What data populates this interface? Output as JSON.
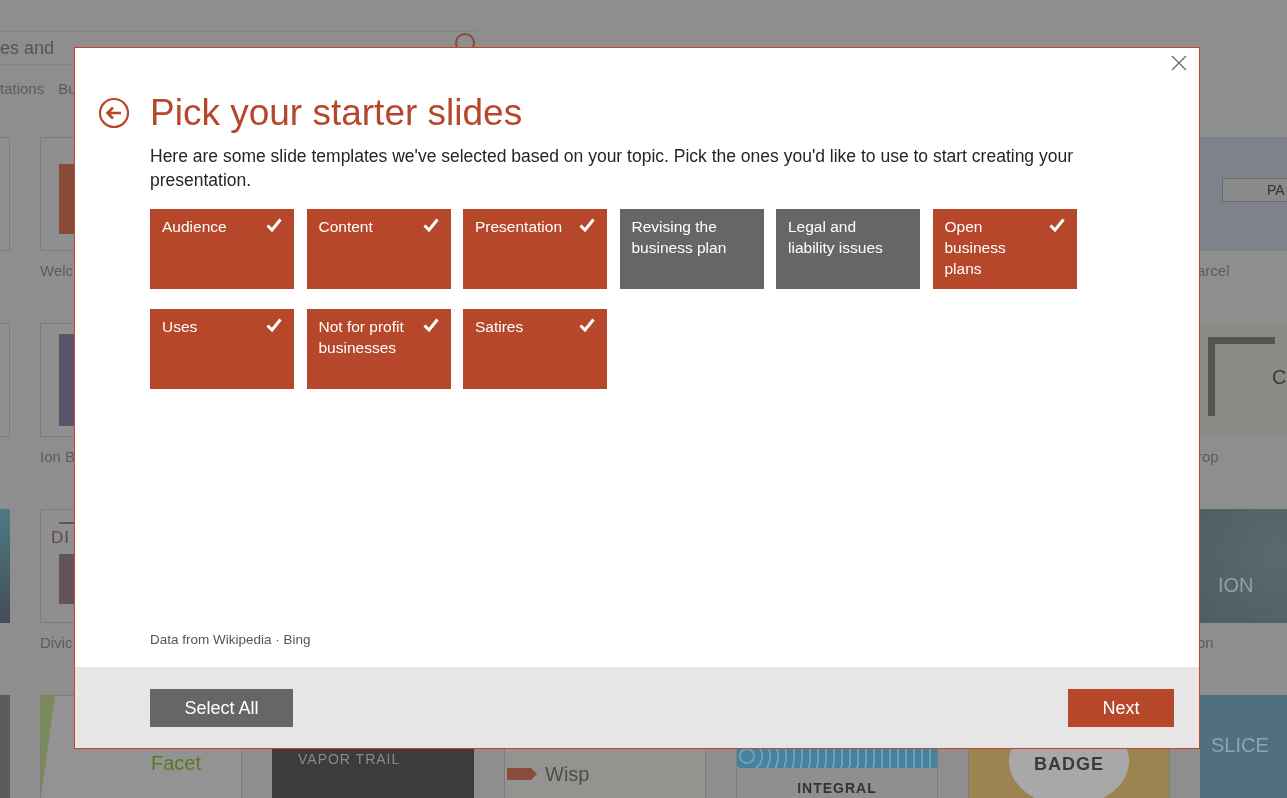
{
  "background": {
    "search": {
      "value": "es and"
    },
    "categories": [
      {
        "label": "tations"
      },
      {
        "label": "Bu"
      }
    ],
    "gallery": [
      {
        "left": [
          {
            "kind": "blank"
          },
          {
            "kind": "welcome",
            "label": "Welc"
          }
        ],
        "right": [
          {
            "kind": "parcel",
            "texts": [
              "PA"
            ],
            "label": "arcel"
          }
        ]
      },
      {
        "left": [
          {
            "kind": "blank"
          },
          {
            "kind": "ion-boardroom",
            "label": "Ion B"
          }
        ],
        "right": [
          {
            "kind": "crop",
            "texts": [
              "C"
            ],
            "label": "rop"
          }
        ]
      },
      {
        "left": [
          {
            "kind": "teal"
          },
          {
            "kind": "dividend",
            "texts": [
              "DI"
            ],
            "label": "Divic"
          }
        ],
        "right": [
          {
            "kind": "ion",
            "texts": [
              "ION"
            ],
            "label": "on"
          }
        ]
      },
      {
        "left": [
          {
            "kind": "dark-pattern"
          },
          {
            "kind": "facet",
            "texts": [
              "Facet"
            ]
          },
          {
            "kind": "vapor",
            "texts": [
              "VAPOR TRAIL"
            ]
          },
          {
            "kind": "wisp",
            "texts": [
              "Wisp"
            ]
          },
          {
            "kind": "integral",
            "texts": [
              "INTEGRAL"
            ]
          },
          {
            "kind": "badge",
            "texts": [
              "BADGE"
            ]
          },
          {
            "kind": "slice",
            "texts": [
              "SLICE"
            ]
          }
        ]
      }
    ]
  },
  "dialog": {
    "title": "Pick your starter slides",
    "description": "Here are some slide templates we've selected based on your topic. Pick the ones you'd like to use to start creating your presentation.",
    "topics": [
      {
        "label": "Audience",
        "checked": true
      },
      {
        "label": "Content",
        "checked": true
      },
      {
        "label": "Presentation",
        "checked": true
      },
      {
        "label": "Revising the business plan",
        "checked": false
      },
      {
        "label": "Legal and liability issues",
        "checked": false
      },
      {
        "label": "Open business plans",
        "checked": true
      },
      {
        "label": "Uses",
        "checked": true
      },
      {
        "label": "Not for profit businesses",
        "checked": true
      },
      {
        "label": "Satires",
        "checked": true
      }
    ],
    "attribution": {
      "prefix": "Data from",
      "links": [
        "Wikipedia",
        "Bing"
      ],
      "separator": "·"
    },
    "buttons": [
      {
        "label": "Select All",
        "kind": "secondary"
      },
      {
        "label": "Next",
        "kind": "primary"
      }
    ]
  }
}
